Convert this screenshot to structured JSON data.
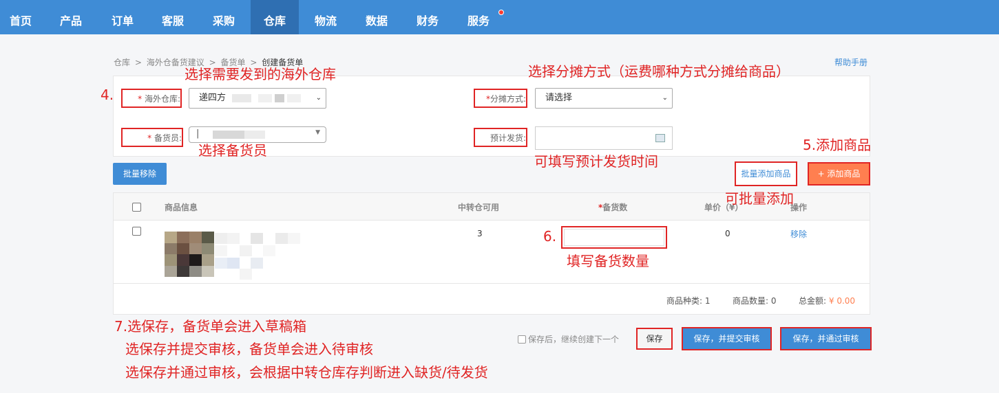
{
  "nav": {
    "items": [
      {
        "label": "首页"
      },
      {
        "label": "产品"
      },
      {
        "label": "订单"
      },
      {
        "label": "客服"
      },
      {
        "label": "采购"
      },
      {
        "label": "仓库"
      },
      {
        "label": "物流"
      },
      {
        "label": "数据"
      },
      {
        "label": "财务"
      },
      {
        "label": "服务"
      }
    ],
    "active": "仓库"
  },
  "breadcrumb": {
    "items": [
      "仓库",
      ">",
      "海外仓备货建议",
      ">",
      "备货单",
      ">",
      "创建备货单"
    ]
  },
  "help_link": "帮助手册",
  "form": {
    "overseas_warehouse": {
      "required_mark": "* ",
      "label": "海外仓库:",
      "value": "递四方"
    },
    "allocation_method": {
      "required_mark": "*",
      "label": "分摊方式:",
      "value": "请选择"
    },
    "stock_person": {
      "required_mark": "* ",
      "label": "备货员:",
      "value": "|"
    },
    "expected_ship": {
      "label": "预计发货:",
      "value": ""
    }
  },
  "toolbar": {
    "batch_remove": "批量移除",
    "batch_add": "批量添加商品",
    "add_product": "+ 添加商品"
  },
  "table": {
    "headers": {
      "product_info": "商品信息",
      "transit_available": "中转仓可用",
      "stock_qty_req": "*",
      "stock_qty": "备货数",
      "unit_price": "单价（¥）",
      "action": "操作"
    },
    "rows": [
      {
        "transit_available": "3",
        "stock_qty": "",
        "unit_price": "0",
        "action": "移除"
      }
    ],
    "summary": {
      "kinds_label": "商品种类:",
      "kinds_value": "1",
      "qty_label": "商品数量:",
      "qty_value": "0",
      "total_label": "总金额:",
      "total_value": "¥ 0.00"
    }
  },
  "footer": {
    "save_next": "保存后，继续创建下一个",
    "save": "保存",
    "save_submit": "保存，并提交审核",
    "save_approve": "保存，并通过审核"
  },
  "annotations": {
    "a4": "4.",
    "a_warehouse": "选择需要发到的海外仓库",
    "a_alloc": "选择分摊方式（运费哪种方式分摊给商品）",
    "a_person": "选择备货员",
    "a_ship": "可填写预计发货时间",
    "a5": "5.添加商品",
    "a_batch": "可批量添加",
    "a6": "6.",
    "a_qty": "填写备货数量",
    "a7_1": "7.选保存，备货单会进入草稿箱",
    "a7_2": "选保存并提交审核，备货单会进入待审核",
    "a7_3": "选保存并通过审核，会根据中转仓库存判断进入缺货/待发货"
  },
  "colors": {
    "nav_bg": "#3f8cd6",
    "annotation": "#e02424",
    "add_button": "#ff7f50",
    "total_amount": "#ff7f50"
  }
}
